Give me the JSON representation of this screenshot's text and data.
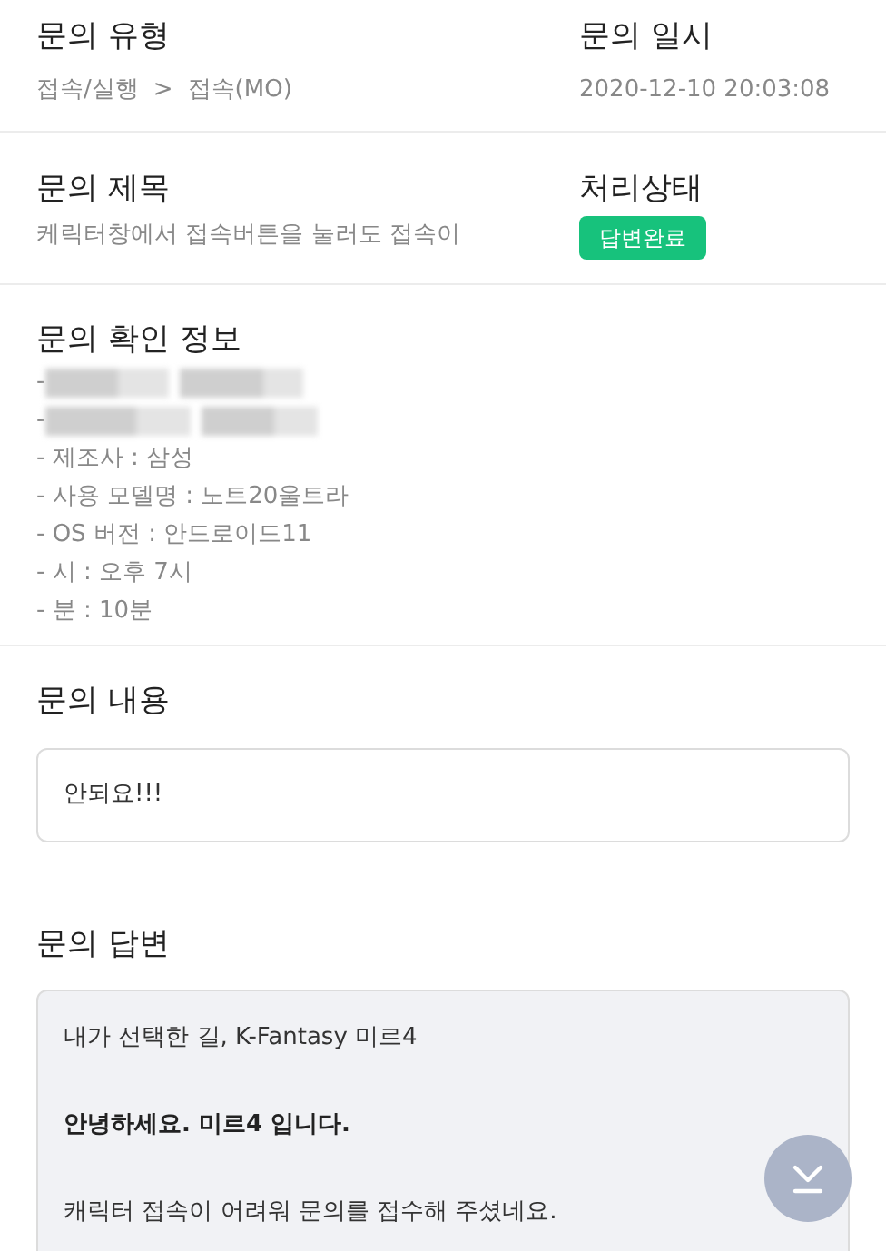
{
  "type_section": {
    "title": "문의 유형",
    "path": [
      "접속/실행",
      ">",
      "접속(MO)"
    ]
  },
  "date_section": {
    "title": "문의 일시",
    "value": "2020-12-10 20:03:08"
  },
  "subject_section": {
    "title": "문의 제목",
    "value": "케릭터창에서 접속버튼을 눌러도 접속이"
  },
  "status_section": {
    "title": "처리상태",
    "badge": "답변완료",
    "color": "#17c27c"
  },
  "info_section": {
    "title": "문의 확인 정보",
    "lines": [
      {
        "kind": "redacted",
        "text": "-"
      },
      {
        "kind": "redacted",
        "text": "-"
      },
      {
        "kind": "text",
        "text": "- 제조사 : 삼성"
      },
      {
        "kind": "text",
        "text": "- 사용 모델명 : 노트20울트라"
      },
      {
        "kind": "text",
        "text": "- OS 버전 : 안드로이드11"
      },
      {
        "kind": "text",
        "text": "- 시 : 오후 7시"
      },
      {
        "kind": "text",
        "text": "- 분 : 10분"
      }
    ]
  },
  "content_section": {
    "title": "문의 내용",
    "value": "안되요!!!"
  },
  "answer_section": {
    "title": "문의 답변",
    "paragraphs": [
      {
        "text": "내가 선택한 길, K-Fantasy 미르4",
        "bold": false
      },
      {
        "text": "안녕하세요. 미르4 입니다.",
        "bold": true
      },
      {
        "text": "캐릭터 접속이 어려워 문의를 접수해 주셨네요.",
        "bold": false
      }
    ]
  }
}
